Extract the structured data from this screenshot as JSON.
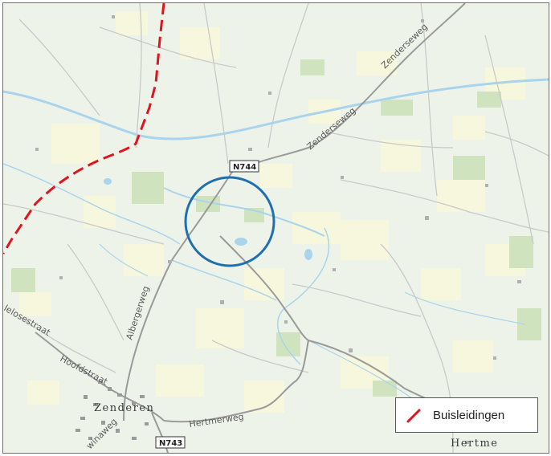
{
  "map": {
    "labels": {
      "zenderseweg_top": "Zenderseweg",
      "zenderseweg_mid": "Zenderseweg",
      "albergerweg": "Albergerweg",
      "hoofdstraat": "Hoofdstraat",
      "hertmerweg": "Hertmerweg",
      "oldenzaalsestraat": "lelosestraat",
      "hengelosestraat": "winaweg"
    },
    "places": {
      "zenderen": "Zenderen",
      "hertme": "Hertme"
    },
    "road_shields": {
      "n744": "N744",
      "n743": "N743"
    },
    "colors": {
      "pipeline": "#e0141e",
      "highlight_circle": "#1f6fb0",
      "water": "#a9d4ec",
      "road_main": "#9a9a9a",
      "land": "#eef3ea",
      "field": "#f6f7dc",
      "forest": "#cfe3bf"
    }
  },
  "legend": {
    "items": [
      {
        "label": "Buisleidingen",
        "symbol": "red-dash-line-icon",
        "color": "#e0141e"
      }
    ]
  }
}
